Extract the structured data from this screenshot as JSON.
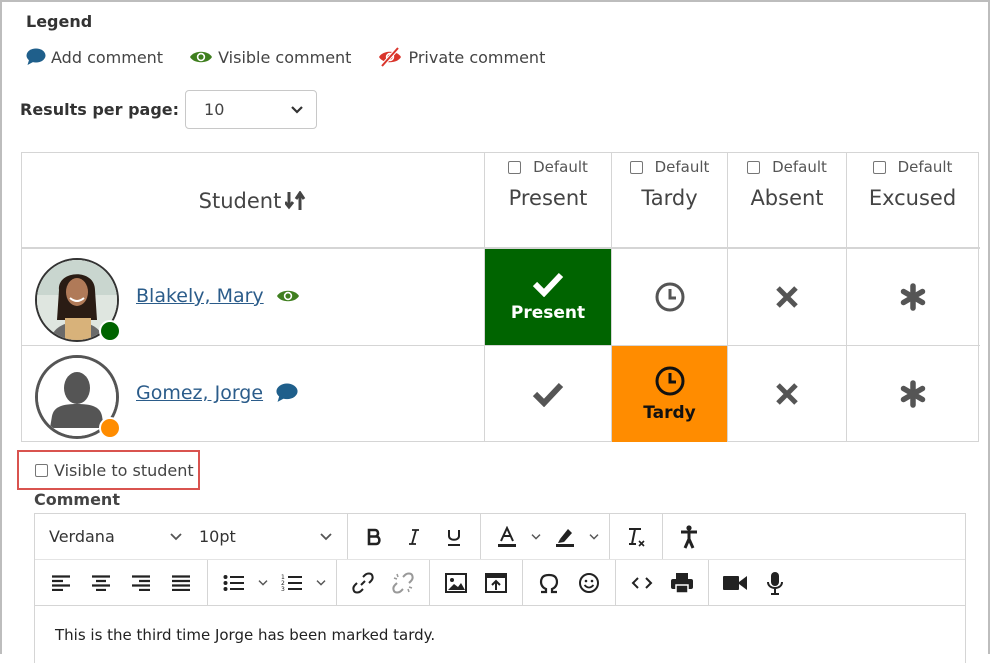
{
  "legend": {
    "title": "Legend",
    "items": [
      {
        "icon": "comment-icon",
        "label": "Add comment",
        "color": "#1f5f8b"
      },
      {
        "icon": "eye-icon",
        "label": "Visible comment",
        "color": "#3f7f1f"
      },
      {
        "icon": "eye-slash-icon",
        "label": "Private comment",
        "color": "#d9342b"
      }
    ]
  },
  "results_per_page": {
    "label": "Results per page:",
    "value": "10"
  },
  "table": {
    "student_header": "Student",
    "columns": [
      {
        "default_label": "Default",
        "name": "Present"
      },
      {
        "default_label": "Default",
        "name": "Tardy"
      },
      {
        "default_label": "Default",
        "name": "Absent"
      },
      {
        "default_label": "Default",
        "name": "Excused"
      }
    ],
    "rows": [
      {
        "name": "Blakely, Mary",
        "status_color": "#006400",
        "comment_icon": "eye-icon",
        "selected": "Present",
        "selected_label": "Present"
      },
      {
        "name": "Gomez, Jorge",
        "status_color": "#ff8c00",
        "comment_icon": "comment-icon",
        "selected": "Tardy",
        "selected_label": "Tardy"
      }
    ]
  },
  "visible_to_student": {
    "label": "Visible to student",
    "checked": false
  },
  "comment": {
    "label": "Comment",
    "font": "Verdana",
    "size": "10pt",
    "text": "This is the third time Jorge has been marked tardy."
  },
  "colors": {
    "present": "#006400",
    "tardy": "#ff8c00",
    "link": "#2b5c8a",
    "highlight_border": "#d9534f"
  }
}
